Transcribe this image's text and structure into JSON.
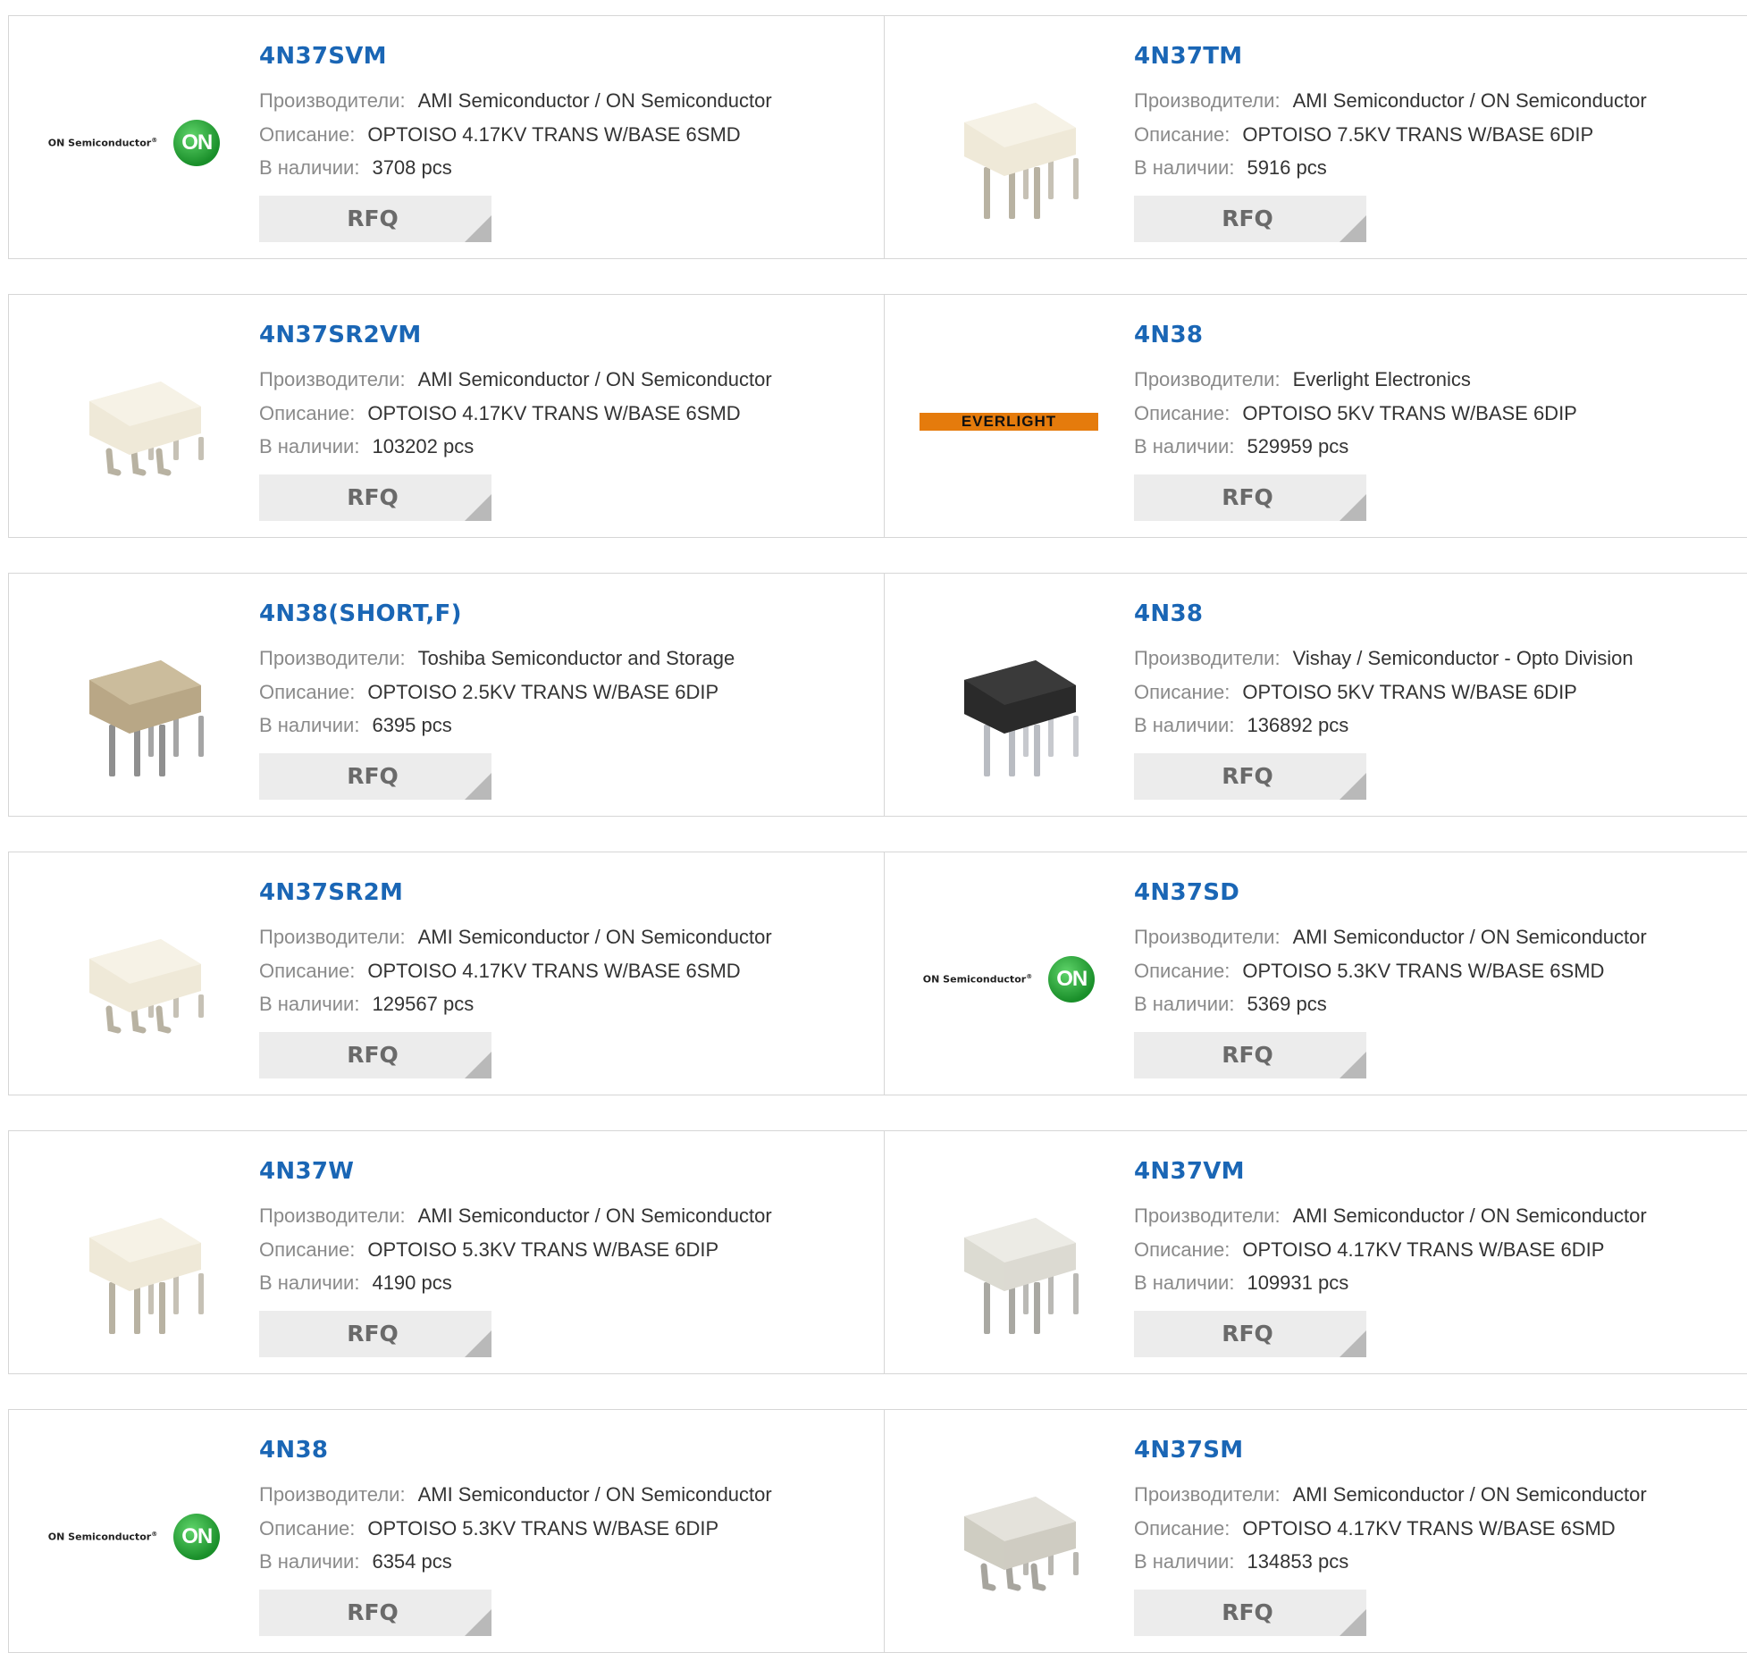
{
  "labels": {
    "manufacturer": "Производители:",
    "description": "Описание:",
    "stock": "В наличии:",
    "rfq": "RFQ"
  },
  "logo_text": {
    "on_semi": "ON Semiconductor",
    "on_mark": "ON",
    "everlight": "EVERLIGHT"
  },
  "colors": {
    "part_link": "#1a66b5",
    "label_grey": "#8a8a8a",
    "button_bg": "#ececec",
    "border": "#d6d6d6"
  },
  "products": [
    {
      "part": "4N37SVM",
      "manufacturer": "AMI Semiconductor / ON Semiconductor",
      "description": "OPTOISO 4.17KV TRANS W/BASE 6SMD",
      "stock": "3708 pcs",
      "image": "on-semi-logo"
    },
    {
      "part": "4N37TM",
      "manufacturer": "AMI Semiconductor / ON Semiconductor",
      "description": "OPTOISO 7.5KV TRANS W/BASE 6DIP",
      "stock": "5916 pcs",
      "image": "white-dip-chip"
    },
    {
      "part": "4N37SR2VM",
      "manufacturer": "AMI Semiconductor / ON Semiconductor",
      "description": "OPTOISO 4.17KV TRANS W/BASE 6SMD",
      "stock": "103202 pcs",
      "image": "white-smd-chip"
    },
    {
      "part": "4N38",
      "manufacturer": "Everlight Electronics",
      "description": "OPTOISO 5KV TRANS W/BASE 6DIP",
      "stock": "529959 pcs",
      "image": "everlight-logo"
    },
    {
      "part": "4N38(SHORT,F)",
      "manufacturer": "Toshiba Semiconductor and Storage",
      "description": "OPTOISO 2.5KV TRANS W/BASE 6DIP",
      "stock": "6395 pcs",
      "image": "beige-dip-chip"
    },
    {
      "part": "4N38",
      "manufacturer": "Vishay / Semiconductor - Opto Division",
      "description": "OPTOISO 5KV TRANS W/BASE 6DIP",
      "stock": "136892 pcs",
      "image": "black-dip-chip"
    },
    {
      "part": "4N37SR2M",
      "manufacturer": "AMI Semiconductor / ON Semiconductor",
      "description": "OPTOISO 4.17KV TRANS W/BASE 6SMD",
      "stock": "129567 pcs",
      "image": "white-smd-chip"
    },
    {
      "part": "4N37SD",
      "manufacturer": "AMI Semiconductor / ON Semiconductor",
      "description": "OPTOISO 5.3KV TRANS W/BASE 6SMD",
      "stock": "5369 pcs",
      "image": "on-semi-logo"
    },
    {
      "part": "4N37W",
      "manufacturer": "AMI Semiconductor / ON Semiconductor",
      "description": "OPTOISO 5.3KV TRANS W/BASE 6DIP",
      "stock": "4190 pcs",
      "image": "white-dip-chip"
    },
    {
      "part": "4N37VM",
      "manufacturer": "AMI Semiconductor / ON Semiconductor",
      "description": "OPTOISO 4.17KV TRANS W/BASE 6DIP",
      "stock": "109931 pcs",
      "image": "grey-dip-chip"
    },
    {
      "part": "4N38",
      "manufacturer": "AMI Semiconductor / ON Semiconductor",
      "description": "OPTOISO 5.3KV TRANS W/BASE 6DIP",
      "stock": "6354 pcs",
      "image": "on-semi-logo"
    },
    {
      "part": "4N37SM",
      "manufacturer": "AMI Semiconductor / ON Semiconductor",
      "description": "OPTOISO 4.17KV TRANS W/BASE 6SMD",
      "stock": "134853 pcs",
      "image": "grey-smd-chip"
    }
  ]
}
